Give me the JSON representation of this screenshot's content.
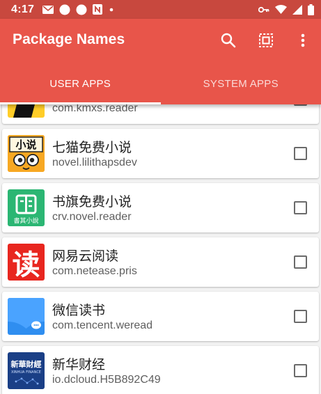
{
  "status_bar": {
    "time": "4:17",
    "left_icons": [
      "mail-icon",
      "circle-icon",
      "circle-icon",
      "n-badge-icon",
      "dot-icon"
    ],
    "right_icons": [
      "key-icon",
      "wifi-icon",
      "signal-icon",
      "battery-icon"
    ]
  },
  "app_bar": {
    "title": "Package Names",
    "color": "#e8554a",
    "actions": [
      "search-icon",
      "select-all-icon",
      "more-vert-icon"
    ]
  },
  "tabs": [
    {
      "label": "USER APPS",
      "active": true
    },
    {
      "label": "SYSTEM APPS",
      "active": false
    }
  ],
  "apps": [
    {
      "name": "",
      "package": "com.kmxs.reader",
      "icon": "kmxs-icon",
      "checked": false
    },
    {
      "name": "七猫免费小说",
      "package": "novel.lilithapsdev",
      "icon": "qimao-icon",
      "icon_text": "小说",
      "checked": false
    },
    {
      "name": "书旗免费小说",
      "package": "crv.novel.reader",
      "icon": "shuqi-icon",
      "icon_text": "書其小說",
      "checked": false
    },
    {
      "name": "网易云阅读",
      "package": "com.netease.pris",
      "icon": "netease-read-icon",
      "icon_text": "读",
      "checked": false
    },
    {
      "name": "微信读书",
      "package": "com.tencent.weread",
      "icon": "weread-icon",
      "checked": false
    },
    {
      "name": "新华财经",
      "package": "io.dcloud.H5B892C49",
      "icon": "xinhua-icon",
      "icon_text": "新華財經",
      "icon_subtext": "XINHUA FINANCE",
      "checked": false
    }
  ]
}
